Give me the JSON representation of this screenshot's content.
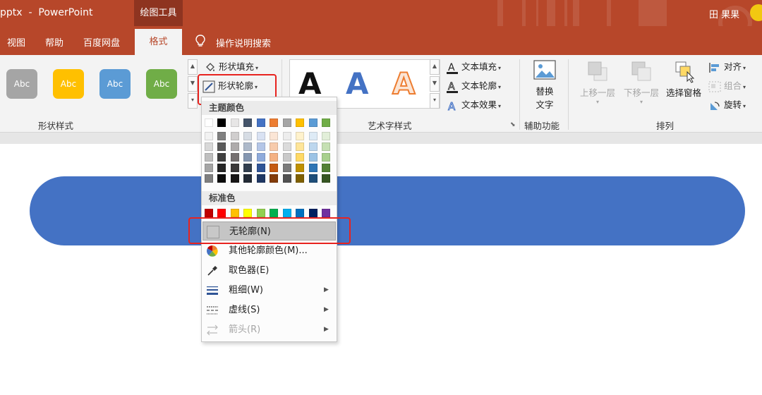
{
  "titlebar": {
    "title": "pptx  -  PowerPoint",
    "context_tab": "绘图工具",
    "user": "田 果果"
  },
  "tabs": {
    "items": [
      "视图",
      "帮助",
      "百度网盘"
    ],
    "active": "格式",
    "tell_me": "操作说明搜索"
  },
  "ribbon": {
    "shape_styles": {
      "label": "形状样式",
      "swatches": [
        {
          "text": "Abc",
          "color": "#a5a5a5"
        },
        {
          "text": "Abc",
          "color": "#ffc000"
        },
        {
          "text": "Abc",
          "color": "#5b9bd5"
        },
        {
          "text": "Abc",
          "color": "#70ad47"
        }
      ],
      "shape_fill": "形状填充",
      "shape_outline": "形状轮廓"
    },
    "wordart": {
      "label": "艺术字样式",
      "sample_letter": "A",
      "text_fill": "文本填充",
      "text_outline": "文本轮廓",
      "text_effects": "文本效果"
    },
    "accessibility": {
      "label": "辅助功能",
      "alt_text_line1": "替换",
      "alt_text_line2": "文字"
    },
    "arrange": {
      "label": "排列",
      "bring_forward": "上移一层",
      "send_backward": "下移一层",
      "selection_pane": "选择窗格",
      "align": "对齐",
      "group": "组合",
      "rotate": "旋转"
    }
  },
  "outline_menu": {
    "theme_colors_heading": "主题颜色",
    "standard_colors_heading": "标准色",
    "theme_top_row": [
      "#ffffff",
      "#000000",
      "#e7e6e6",
      "#44546a",
      "#4472c4",
      "#ed7d31",
      "#a5a5a5",
      "#ffc000",
      "#5b9bd5",
      "#70ad47"
    ],
    "theme_shades": [
      [
        "#f2f2f2",
        "#7f7f7f",
        "#d0cece",
        "#d6dce4",
        "#d9e2f3",
        "#fbe5d5",
        "#ededed",
        "#fff2cc",
        "#deebf6",
        "#e2efd9"
      ],
      [
        "#d8d8d8",
        "#595959",
        "#aeabab",
        "#adb9ca",
        "#b4c6e7",
        "#f7cbac",
        "#dbdbdb",
        "#fee599",
        "#bdd7ee",
        "#c5e0b3"
      ],
      [
        "#bfbfbf",
        "#3f3f3f",
        "#757070",
        "#8496b0",
        "#8eaadb",
        "#f4b183",
        "#c9c9c9",
        "#ffd965",
        "#9cc3e5",
        "#a8d08d"
      ],
      [
        "#a5a5a5",
        "#262626",
        "#3a3838",
        "#323f4f",
        "#2f5496",
        "#c55a11",
        "#7b7b7b",
        "#bf9000",
        "#2e75b5",
        "#538135"
      ],
      [
        "#7f7f7f",
        "#0c0c0c",
        "#171616",
        "#222a35",
        "#1f3864",
        "#833c0b",
        "#525252",
        "#7f6000",
        "#1e4e79",
        "#375623"
      ]
    ],
    "standard_colors": [
      "#c00000",
      "#ff0000",
      "#ffc000",
      "#ffff00",
      "#92d050",
      "#00b050",
      "#00b0f0",
      "#0070c0",
      "#002060",
      "#7030a0"
    ],
    "items": [
      {
        "label": "无轮廓(N)",
        "icon": "no-outline-icon",
        "highlighted": true,
        "submenu": false,
        "disabled": false
      },
      {
        "label": "其他轮廓颜色(M)...",
        "icon": "color-wheel-icon",
        "highlighted": false,
        "submenu": false,
        "disabled": false
      },
      {
        "label": "取色器(E)",
        "icon": "eyedropper-icon",
        "highlighted": false,
        "submenu": false,
        "disabled": false
      },
      {
        "label": "粗细(W)",
        "icon": "line-weight-icon",
        "highlighted": false,
        "submenu": true,
        "disabled": false
      },
      {
        "label": "虚线(S)",
        "icon": "dashes-icon",
        "highlighted": false,
        "submenu": true,
        "disabled": false
      },
      {
        "label": "箭头(R)",
        "icon": "arrows-icon",
        "highlighted": false,
        "submenu": true,
        "disabled": true
      }
    ]
  },
  "colors": {
    "accent": "#b7472a",
    "shape_fill": "#4472c4",
    "highlight_box": "#e8231f"
  }
}
